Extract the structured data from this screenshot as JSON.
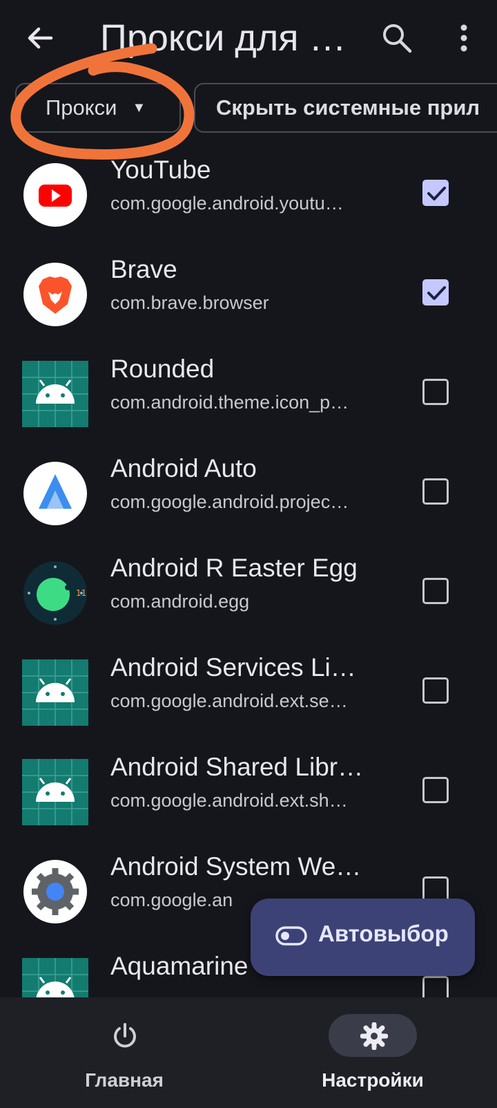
{
  "header": {
    "title": "Прокси для …"
  },
  "filters": {
    "mode_label": "Прокси",
    "hide_system_label": "Скрыть системные прил"
  },
  "apps": [
    {
      "name": "YouTube",
      "package": "com.google.android.youtu…",
      "checked": true,
      "icon": "youtube-icon"
    },
    {
      "name": "Brave",
      "package": "com.brave.browser",
      "checked": true,
      "icon": "brave-lion-icon"
    },
    {
      "name": "Rounded",
      "package": "com.android.theme.icon_p…",
      "checked": false,
      "icon": "android-robot-icon"
    },
    {
      "name": "Android Auto",
      "package": "com.google.android.projec…",
      "checked": false,
      "icon": "android-auto-icon"
    },
    {
      "name": "Android R Easter Egg",
      "package": "com.android.egg",
      "checked": false,
      "icon": "easter-egg-icon"
    },
    {
      "name": "Android Services Li…",
      "package": "com.google.android.ext.se…",
      "checked": false,
      "icon": "android-robot-icon"
    },
    {
      "name": "Android Shared Libr…",
      "package": "com.google.android.ext.sh…",
      "checked": false,
      "icon": "android-robot-icon"
    },
    {
      "name": "Android System We…",
      "package": "com.google.an",
      "checked": false,
      "icon": "webview-gear-icon"
    },
    {
      "name": "Aquamarine",
      "package": "",
      "checked": false,
      "icon": "android-robot-icon"
    }
  ],
  "fab": {
    "label": "Автовыбор"
  },
  "bottom_nav": {
    "home_label": "Главная",
    "settings_label": "Настройки"
  },
  "colors": {
    "background": "#15161b",
    "checkbox_checked": "#c4c8ff",
    "fab": "#3d4276",
    "annotation": "#f0743a"
  }
}
